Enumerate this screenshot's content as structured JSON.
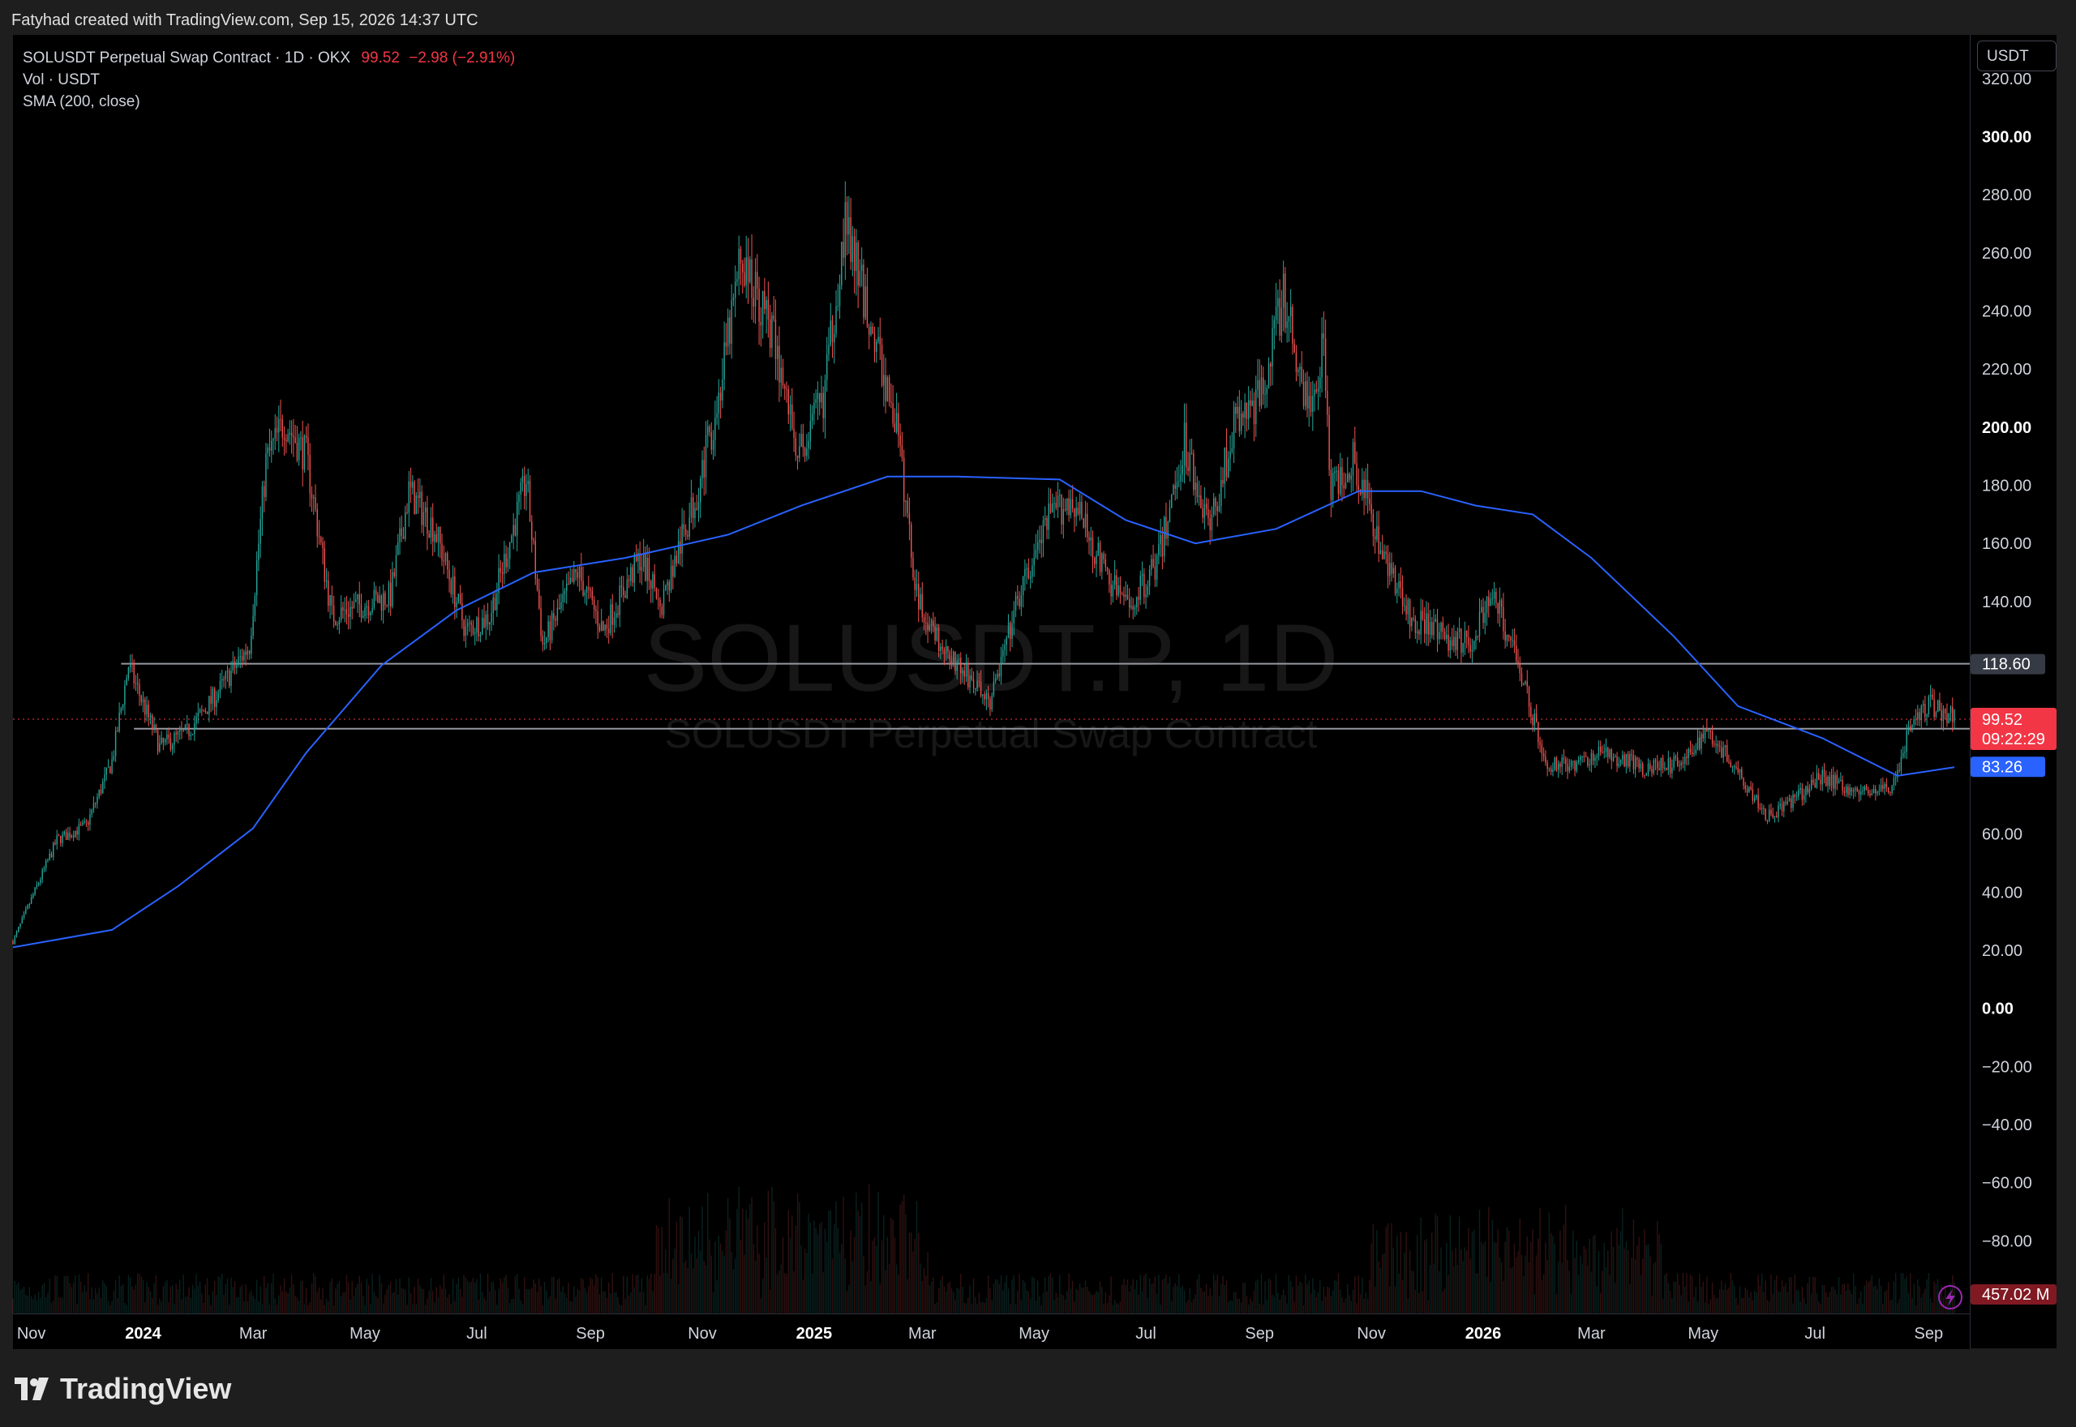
{
  "header": {
    "attribution": "Fatyhad created with TradingView.com, Sep 15, 2026 14:37 UTC"
  },
  "legend": {
    "symbol": "SOLUSDT Perpetual Swap Contract · 1D · OKX",
    "price": "99.52",
    "change": "−2.98 (−2.91%)",
    "volume": "Vol · USDT",
    "sma": "SMA (200, close)"
  },
  "unit_selector": "USDT",
  "watermark": {
    "symbol": "SOLUSDT.P, 1D",
    "name": "SOLUSDT Perpetual Swap Contract"
  },
  "logo": {
    "text": "TradingView"
  },
  "colors": {
    "up": "#26a69a",
    "down": "#ef5350",
    "sma": "#2962ff",
    "hline": "#9598a1",
    "price_label": "#f23645",
    "sma_label": "#2962ff",
    "level_label": "#363a45"
  },
  "chart_data": {
    "type": "candlestick",
    "x_axis": {
      "tick_labels": [
        "Nov",
        "2024",
        "Mar",
        "May",
        "Jul",
        "Sep",
        "Nov",
        "2025",
        "Mar",
        "May",
        "Jul",
        "Sep",
        "Nov",
        "2026",
        "Mar",
        "May",
        "Jul",
        "Sep"
      ],
      "bold_labels": [
        "2024",
        "2025",
        "2026"
      ],
      "range": [
        "2023-10-22",
        "2026-09-15"
      ]
    },
    "y_axis": {
      "tick_labels": [
        "320.00",
        "300.00",
        "280.00",
        "260.00",
        "240.00",
        "220.00",
        "200.00",
        "180.00",
        "160.00",
        "140.00",
        "60.00",
        "40.00",
        "20.00",
        "0.00",
        "−20.00",
        "−40.00",
        "−60.00",
        "−80.00"
      ],
      "bold_labels": [
        "300.00",
        "200.00",
        "0.00"
      ],
      "range": [
        -105,
        335
      ],
      "unit": "USDT"
    },
    "price_path": [
      [
        "2023-10-22",
        23
      ],
      [
        "2023-11-15",
        58
      ],
      [
        "2023-12-01",
        63
      ],
      [
        "2023-12-15",
        85
      ],
      [
        "2023-12-24",
        118
      ],
      [
        "2024-01-10",
        90
      ],
      [
        "2024-01-25",
        95
      ],
      [
        "2024-02-10",
        108
      ],
      [
        "2024-02-28",
        125
      ],
      [
        "2024-03-08",
        188
      ],
      [
        "2024-03-18",
        202
      ],
      [
        "2024-03-30",
        190
      ],
      [
        "2024-04-13",
        135
      ],
      [
        "2024-04-25",
        138
      ],
      [
        "2024-05-15",
        142
      ],
      [
        "2024-05-25",
        178
      ],
      [
        "2024-06-08",
        165
      ],
      [
        "2024-06-25",
        130
      ],
      [
        "2024-07-08",
        135
      ],
      [
        "2024-07-28",
        182
      ],
      [
        "2024-08-06",
        125
      ],
      [
        "2024-08-25",
        150
      ],
      [
        "2024-09-08",
        130
      ],
      [
        "2024-09-28",
        155
      ],
      [
        "2024-10-10",
        140
      ],
      [
        "2024-10-28",
        175
      ],
      [
        "2024-11-10",
        210
      ],
      [
        "2024-11-22",
        258
      ],
      [
        "2024-12-08",
        235
      ],
      [
        "2024-12-24",
        190
      ],
      [
        "2025-01-06",
        210
      ],
      [
        "2025-01-18",
        270
      ],
      [
        "2025-01-30",
        240
      ],
      [
        "2025-02-15",
        200
      ],
      [
        "2025-02-26",
        142
      ],
      [
        "2025-03-12",
        125
      ],
      [
        "2025-04-07",
        105
      ],
      [
        "2025-04-22",
        140
      ],
      [
        "2025-05-10",
        170
      ],
      [
        "2025-05-22",
        175
      ],
      [
        "2025-06-10",
        148
      ],
      [
        "2025-06-22",
        138
      ],
      [
        "2025-07-08",
        155
      ],
      [
        "2025-07-22",
        195
      ],
      [
        "2025-08-05",
        165
      ],
      [
        "2025-08-18",
        200
      ],
      [
        "2025-09-01",
        210
      ],
      [
        "2025-09-14",
        245
      ],
      [
        "2025-09-28",
        205
      ],
      [
        "2025-10-06",
        230
      ],
      [
        "2025-10-10",
        178
      ],
      [
        "2025-10-22",
        190
      ],
      [
        "2025-11-05",
        162
      ],
      [
        "2025-11-22",
        135
      ],
      [
        "2025-12-10",
        128
      ],
      [
        "2025-12-25",
        126
      ],
      [
        "2026-01-06",
        142
      ],
      [
        "2026-01-20",
        120
      ],
      [
        "2026-02-04",
        84
      ],
      [
        "2026-02-20",
        84
      ],
      [
        "2026-03-08",
        88
      ],
      [
        "2026-03-28",
        83
      ],
      [
        "2026-04-20",
        84
      ],
      [
        "2026-05-03",
        96
      ],
      [
        "2026-05-20",
        82
      ],
      [
        "2026-06-05",
        66
      ],
      [
        "2026-06-20",
        72
      ],
      [
        "2026-07-05",
        80
      ],
      [
        "2026-07-25",
        74
      ],
      [
        "2026-08-12",
        76
      ],
      [
        "2026-08-22",
        97
      ],
      [
        "2026-09-01",
        105
      ],
      [
        "2026-09-15",
        99.5
      ]
    ],
    "sma200_path": [
      [
        "2023-10-22",
        21
      ],
      [
        "2023-12-15",
        27
      ],
      [
        "2024-01-20",
        42
      ],
      [
        "2024-03-01",
        62
      ],
      [
        "2024-03-30",
        88
      ],
      [
        "2024-05-10",
        118
      ],
      [
        "2024-06-20",
        137
      ],
      [
        "2024-08-01",
        150
      ],
      [
        "2024-09-20",
        155
      ],
      [
        "2024-11-15",
        163
      ],
      [
        "2024-12-25",
        173
      ],
      [
        "2025-02-10",
        183
      ],
      [
        "2025-03-20",
        183
      ],
      [
        "2025-05-15",
        182
      ],
      [
        "2025-06-20",
        168
      ],
      [
        "2025-07-28",
        160
      ],
      [
        "2025-09-10",
        165
      ],
      [
        "2025-10-25",
        178
      ],
      [
        "2025-11-28",
        178
      ],
      [
        "2025-12-28",
        173
      ],
      [
        "2026-01-28",
        170
      ],
      [
        "2026-03-01",
        155
      ],
      [
        "2026-04-15",
        128
      ],
      [
        "2026-05-20",
        104
      ],
      [
        "2026-07-05",
        93
      ],
      [
        "2026-08-15",
        80
      ],
      [
        "2026-09-15",
        83
      ]
    ],
    "horizontal_levels": [
      {
        "value": 118.6,
        "label": "118.60",
        "from": "2023-12-20"
      },
      {
        "value": 96.24,
        "label": "96.24",
        "from": "2023-12-27"
      }
    ],
    "last_price": {
      "value": 99.52,
      "label": "99.52",
      "countdown": "09:22:29"
    },
    "sma_last": {
      "value": 83.26,
      "label": "83.26"
    },
    "volume_last": {
      "label": "457.02 M"
    }
  }
}
